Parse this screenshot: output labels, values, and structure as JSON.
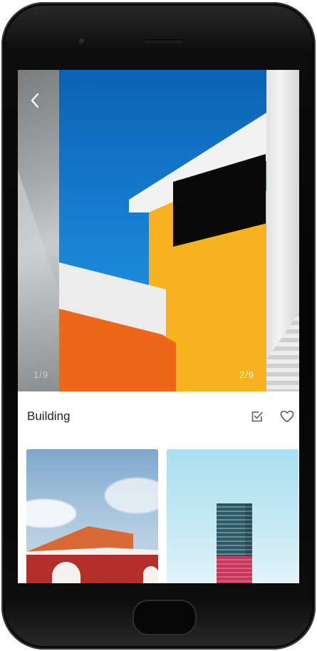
{
  "header": {
    "back_icon": "chevron-left-icon"
  },
  "carousel": {
    "prev_counter": "1/9",
    "current_counter": "2/9"
  },
  "wallpaper": {
    "title": "Building",
    "apply_icon": "checkbox-icon",
    "favorite_icon": "heart-icon"
  },
  "colors": {
    "sky_blue": "#0f73c7",
    "wall_yellow": "#f6b21f",
    "wall_orange": "#ee6718",
    "phone_frame": "#0a0a0a"
  }
}
